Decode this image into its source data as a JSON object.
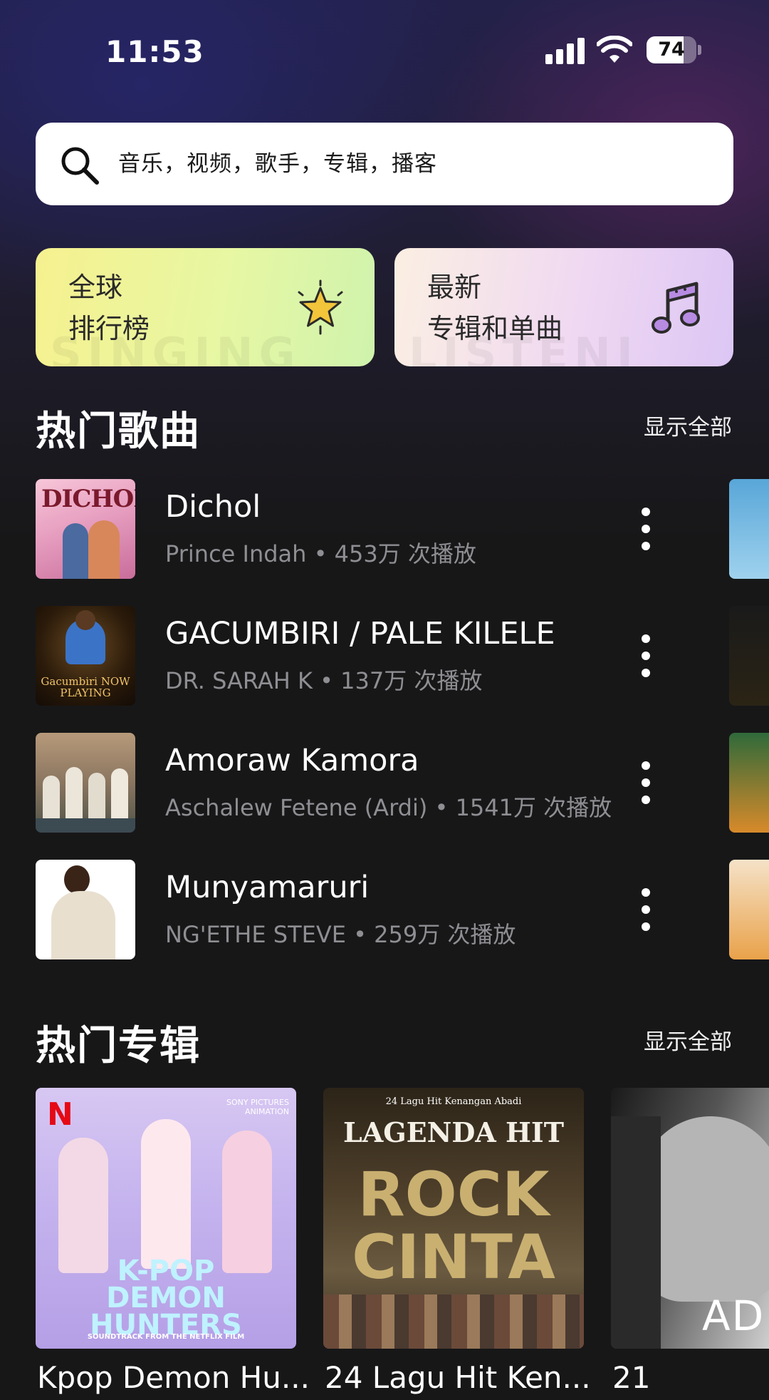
{
  "status_bar": {
    "time": "11:53",
    "battery": "74",
    "battery_level": 0.74
  },
  "search": {
    "placeholder": "音乐，视频，歌手，专辑，播客"
  },
  "categories": [
    {
      "line1": "全球",
      "line2": "排行榜",
      "icon": "star-icon",
      "watermark": "SINGING",
      "color": "#eef59a"
    },
    {
      "line1": "最新",
      "line2": "专辑和单曲",
      "icon": "music-note-icon",
      "watermark": "LISTENI",
      "color": "#ecd9f2"
    }
  ],
  "hot_songs": {
    "title": "热门歌曲",
    "show_all": "显示全部",
    "items": [
      {
        "title": "Dichol",
        "subtitle": "Prince Indah • 453万 次播放",
        "art_text": "DICHOL"
      },
      {
        "title": "GACUMBIRI / PALE KILELE",
        "subtitle": "DR. SARAH K • 137万 次播放",
        "art_text": "Gacumbiri NOW PLAYING"
      },
      {
        "title": "Amoraw Kamora",
        "subtitle": "Aschalew Fetene (Ardi) • 1541万 次播放",
        "art_text": ""
      },
      {
        "title": "Munyamaruri",
        "subtitle": "NG'ETHE STEVE • 259万 次播放",
        "art_text": ""
      }
    ]
  },
  "hot_albums": {
    "title": "热门专辑",
    "show_all": "显示全部",
    "items": [
      {
        "name": "Kpop Demon Hu...",
        "cover_lines": [
          "K-POP",
          "DEMON",
          "HUNTERS"
        ],
        "cover_sub": "SOUNDTRACK FROM THE NETFLIX FILM",
        "badge": "N",
        "corner": "SONY PICTURES ANIMATION"
      },
      {
        "name": "24 Lagu Hit Ken...",
        "cover_top": "24 Lagu Hit Kenangan Abadi",
        "cover_lines": [
          "LAGENDA HIT",
          "ROCK",
          "CINTA"
        ]
      },
      {
        "name": "21",
        "cover_lines": [
          "ADE"
        ]
      }
    ]
  }
}
